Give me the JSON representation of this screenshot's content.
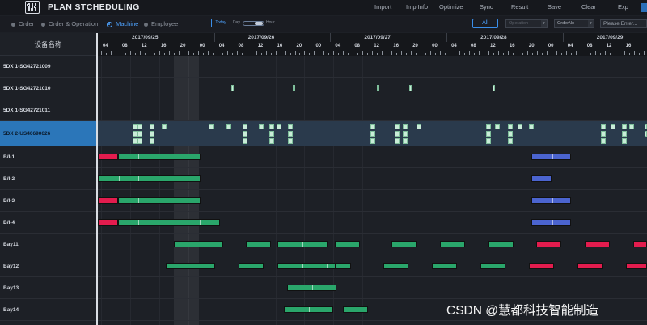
{
  "app": {
    "title": "PLAN  STCHEDULING",
    "logo_icon": "sliders-logo-icon"
  },
  "menu": [
    "Import",
    "Imp.Info",
    "Optimize",
    "Sync",
    "Result",
    "Save",
    "Clear",
    "Exp"
  ],
  "view_options": [
    {
      "label": "Order",
      "selected": false
    },
    {
      "label": "Order & Operation",
      "selected": false
    },
    {
      "label": "Machine",
      "selected": true
    },
    {
      "label": "Employee",
      "selected": false
    }
  ],
  "zoom": {
    "today": "Today",
    "day": "Day",
    "hour": "Hour"
  },
  "filters": {
    "all": "All",
    "operation": "Operation",
    "order_no": "OrderNo",
    "search_placeholder": "Please Enter..."
  },
  "gantt": {
    "left_header": "设备名称",
    "dates": [
      "2017/09/25",
      "2017/09/26",
      "2017/09/27",
      "2017/09/28",
      "2017/09/29"
    ],
    "hours": [
      "04",
      "08",
      "12",
      "16",
      "20",
      "00"
    ],
    "rows": [
      {
        "name": "5DX 1-SG42721009",
        "selected": false
      },
      {
        "name": "5DX 1-SG42721010",
        "selected": false
      },
      {
        "name": "5DX 1-SG42721011",
        "selected": false
      },
      {
        "name": "5DX 2-US40690626",
        "selected": true
      },
      {
        "name": "B/I-1",
        "selected": false
      },
      {
        "name": "B/I-2",
        "selected": false
      },
      {
        "name": "B/I-3",
        "selected": false
      },
      {
        "name": "B/I-4",
        "selected": false
      },
      {
        "name": "Bay11",
        "selected": false
      },
      {
        "name": "Bay12",
        "selected": false
      },
      {
        "name": "Bay13",
        "selected": false
      },
      {
        "name": "Bay14",
        "selected": false
      }
    ],
    "colors": {
      "red": "#e31c4e",
      "green": "#2aa66b",
      "blue": "#4b64cf",
      "block": "#c9ecd8",
      "accent": "#2b76b9"
    }
  },
  "watermark": "CSDN @慧都科技智能制造"
}
